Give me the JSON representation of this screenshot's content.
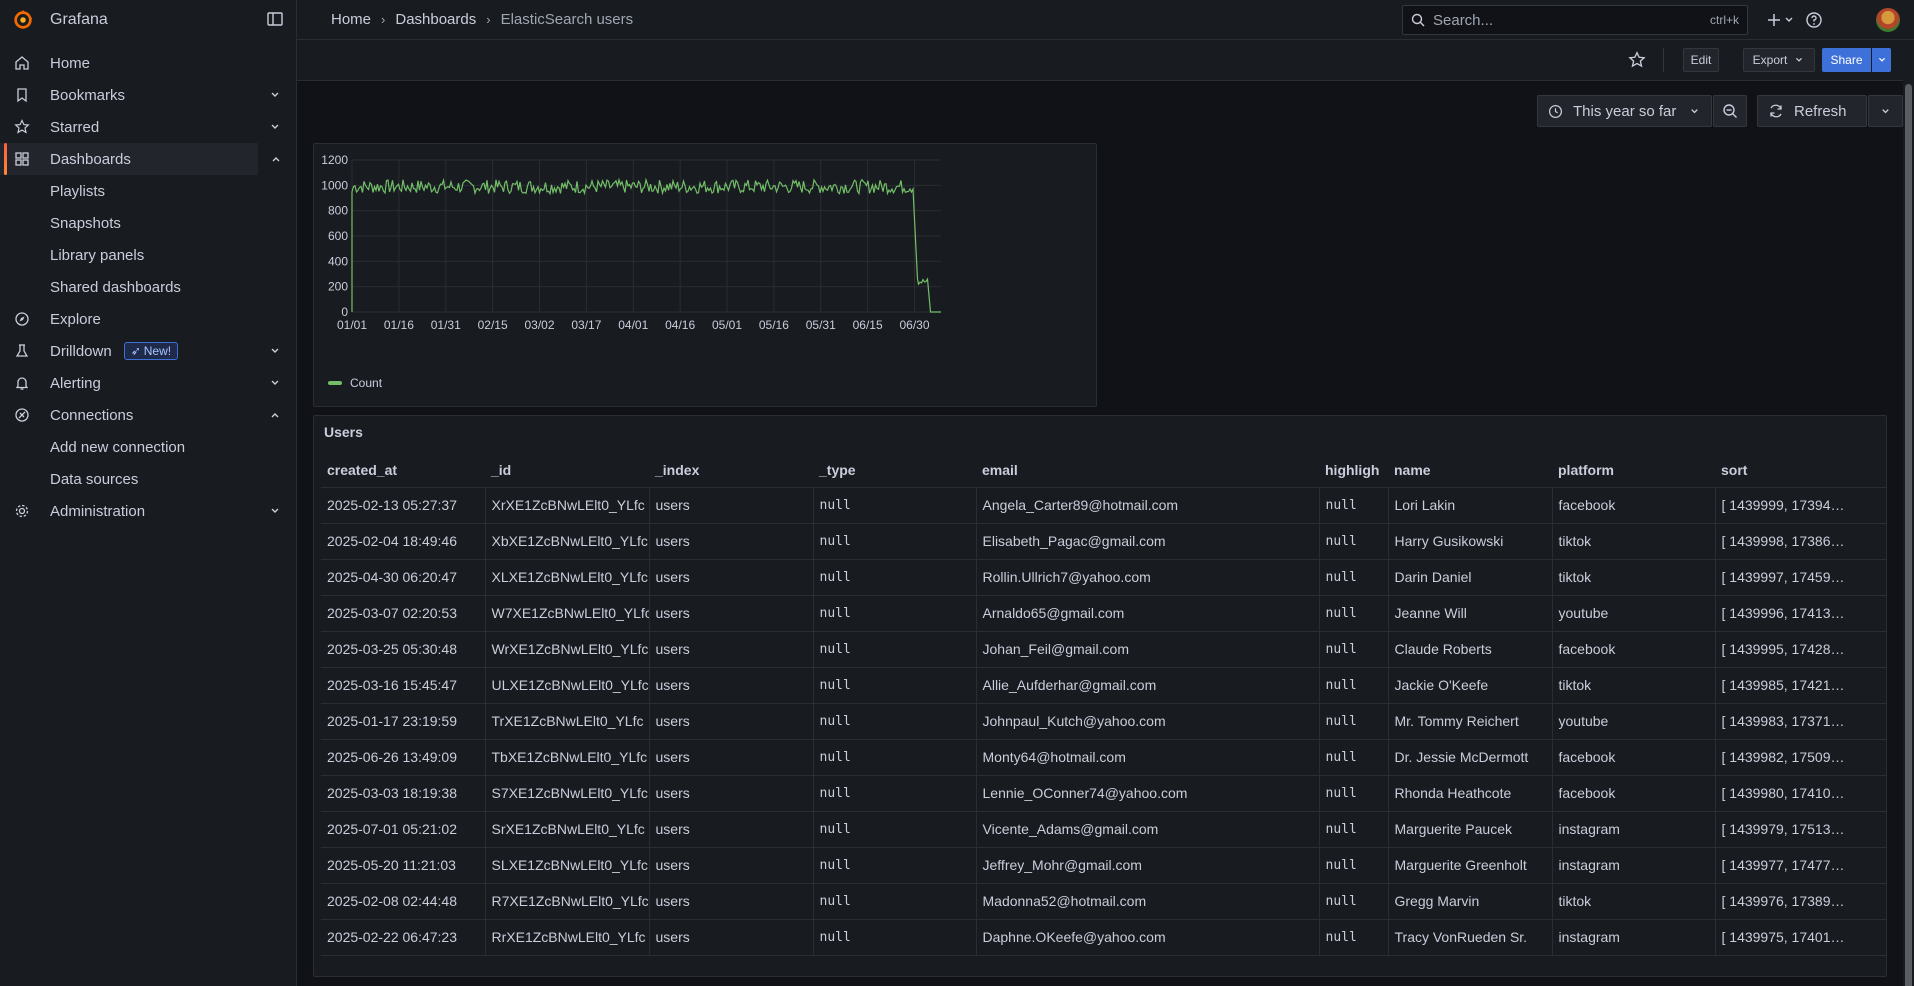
{
  "app": {
    "name": "Grafana"
  },
  "sidebar": {
    "items": [
      {
        "label": "Home",
        "icon": "home-icon"
      },
      {
        "label": "Bookmarks",
        "icon": "bookmark-icon"
      },
      {
        "label": "Starred",
        "icon": "star-icon"
      },
      {
        "label": "Dashboards",
        "icon": "apps-icon"
      },
      {
        "label": "Explore",
        "icon": "compass-icon"
      },
      {
        "label": "Drilldown",
        "icon": "drilldown-icon",
        "badge": "New!"
      },
      {
        "label": "Alerting",
        "icon": "bell-icon"
      },
      {
        "label": "Connections",
        "icon": "connections-icon"
      },
      {
        "label": "Administration",
        "icon": "gear-icon"
      }
    ],
    "dashboards_sub": [
      "Playlists",
      "Snapshots",
      "Library panels",
      "Shared dashboards"
    ],
    "connections_sub": [
      "Add new connection",
      "Data sources"
    ]
  },
  "breadcrumb": {
    "home": "Home",
    "dashboards": "Dashboards",
    "current": "ElasticSearch users"
  },
  "search": {
    "placeholder": "Search...",
    "shortcut": "ctrl+k"
  },
  "toolbar": {
    "edit": "Edit",
    "export": "Export",
    "share": "Share"
  },
  "time": {
    "range": "This year so far",
    "refresh": "Refresh"
  },
  "chart_data": {
    "type": "line",
    "title": "",
    "x_ticks": [
      "01/01",
      "01/16",
      "01/31",
      "02/15",
      "03/02",
      "03/17",
      "04/01",
      "04/16",
      "05/01",
      "05/16",
      "05/31",
      "06/15",
      "06/30"
    ],
    "y_ticks": [
      "0",
      "200",
      "400",
      "600",
      "800",
      "1000",
      "1200"
    ],
    "ylim": [
      0,
      1200
    ],
    "series": [
      {
        "name": "Count",
        "color": "#73bf69",
        "description": "flat near 1000 from 01/01 to ~06/30, drops to ~250 until ~07/03, then 0"
      }
    ],
    "legend": "bottom-left"
  },
  "table": {
    "title": "Users",
    "columns": [
      "created_at",
      "_id",
      "_index",
      "_type",
      "email",
      "highligh",
      "name",
      "platform",
      "sort"
    ],
    "rows": [
      [
        "2025-02-13 05:27:37",
        "XrXE1ZcBNwLElt0_YLfc",
        "users",
        "null",
        "Angela_Carter89@hotmail.com",
        "null",
        "Lori Lakin",
        "facebook",
        "[ 1439999, 17394…"
      ],
      [
        "2025-02-04 18:49:46",
        "XbXE1ZcBNwLElt0_YLfc",
        "users",
        "null",
        "Elisabeth_Pagac@gmail.com",
        "null",
        "Harry Gusikowski",
        "tiktok",
        "[ 1439998, 17386…"
      ],
      [
        "2025-04-30 06:20:47",
        "XLXE1ZcBNwLElt0_YLfc",
        "users",
        "null",
        "Rollin.Ullrich7@yahoo.com",
        "null",
        "Darin Daniel",
        "tiktok",
        "[ 1439997, 17459…"
      ],
      [
        "2025-03-07 02:20:53",
        "W7XE1ZcBNwLElt0_YLfc",
        "users",
        "null",
        "Arnaldo65@gmail.com",
        "null",
        "Jeanne Will",
        "youtube",
        "[ 1439996, 17413…"
      ],
      [
        "2025-03-25 05:30:48",
        "WrXE1ZcBNwLElt0_YLfc",
        "users",
        "null",
        "Johan_Feil@gmail.com",
        "null",
        "Claude Roberts",
        "facebook",
        "[ 1439995, 17428…"
      ],
      [
        "2025-03-16 15:45:47",
        "ULXE1ZcBNwLElt0_YLfc",
        "users",
        "null",
        "Allie_Aufderhar@gmail.com",
        "null",
        "Jackie O'Keefe",
        "tiktok",
        "[ 1439985, 17421…"
      ],
      [
        "2025-01-17 23:19:59",
        "TrXE1ZcBNwLElt0_YLfc",
        "users",
        "null",
        "Johnpaul_Kutch@yahoo.com",
        "null",
        "Mr. Tommy Reichert",
        "youtube",
        "[ 1439983, 17371…"
      ],
      [
        "2025-06-26 13:49:09",
        "TbXE1ZcBNwLElt0_YLfc",
        "users",
        "null",
        "Monty64@hotmail.com",
        "null",
        "Dr. Jessie McDermott",
        "facebook",
        "[ 1439982, 17509…"
      ],
      [
        "2025-03-03 18:19:38",
        "S7XE1ZcBNwLElt0_YLfc",
        "users",
        "null",
        "Lennie_OConner74@yahoo.com",
        "null",
        "Rhonda Heathcote",
        "facebook",
        "[ 1439980, 17410…"
      ],
      [
        "2025-07-01 05:21:02",
        "SrXE1ZcBNwLElt0_YLfc",
        "users",
        "null",
        "Vicente_Adams@gmail.com",
        "null",
        "Marguerite Paucek",
        "instagram",
        "[ 1439979, 17513…"
      ],
      [
        "2025-05-20 11:21:03",
        "SLXE1ZcBNwLElt0_YLfc",
        "users",
        "null",
        "Jeffrey_Mohr@gmail.com",
        "null",
        "Marguerite Greenholt",
        "instagram",
        "[ 1439977, 17477…"
      ],
      [
        "2025-02-08 02:44:48",
        "R7XE1ZcBNwLElt0_YLfc",
        "users",
        "null",
        "Madonna52@hotmail.com",
        "null",
        "Gregg Marvin",
        "tiktok",
        "[ 1439976, 17389…"
      ],
      [
        "2025-02-22 06:47:23",
        "RrXE1ZcBNwLElt0_YLfc",
        "users",
        "null",
        "Daphne.OKeefe@yahoo.com",
        "null",
        "Tracy VonRueden Sr.",
        "instagram",
        "[ 1439975, 17401…"
      ]
    ]
  }
}
